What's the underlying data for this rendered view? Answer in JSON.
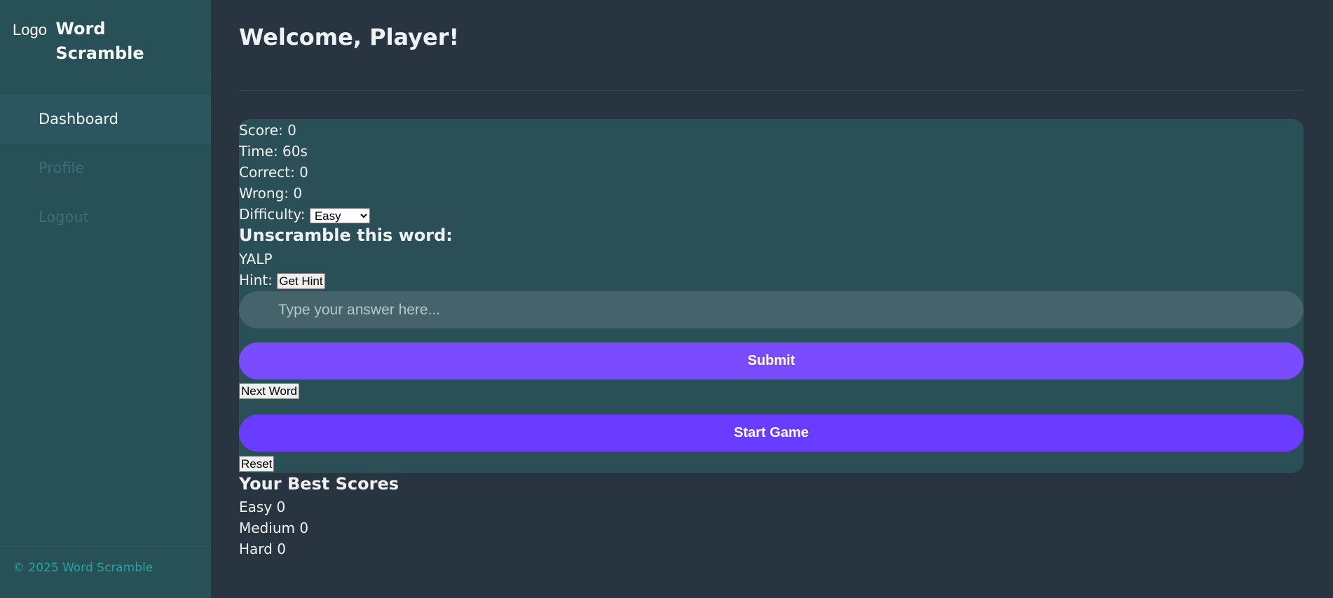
{
  "sidebar": {
    "logo_alt": "Logo",
    "app_title": "Word Scramble",
    "nav": [
      {
        "label": "Dashboard"
      },
      {
        "label": "Profile"
      },
      {
        "label": "Logout"
      }
    ],
    "footer": "© 2025 Word Scramble"
  },
  "header": {
    "title": "Welcome, Player!"
  },
  "game": {
    "score_label": "Score:",
    "score_value": "0",
    "time_label": "Time:",
    "time_value": "60s",
    "correct_label": "Correct:",
    "correct_value": "0",
    "wrong_label": "Wrong:",
    "wrong_value": "0",
    "difficulty_label": "Difficulty:",
    "difficulty_selected": "Easy",
    "prompt": "Unscramble this word:",
    "scrambled_word": "YALP",
    "hint_label": "Hint:",
    "hint_button": "Get Hint",
    "answer_placeholder": "Type your answer here...",
    "answer_value": "",
    "submit_button": "Submit",
    "next_button": "Next Word",
    "start_button": "Start Game",
    "reset_button": "Reset"
  },
  "best_scores": {
    "title": "Your Best Scores",
    "rows": [
      {
        "level": "Easy",
        "score": "0"
      },
      {
        "level": "Medium",
        "score": "0"
      },
      {
        "level": "Hard",
        "score": "0"
      }
    ]
  },
  "colors": {
    "background": "#283440",
    "sidebar": "#275057",
    "card": "#2a4f56",
    "submit": "#7b4bff",
    "start": "#6a3cff",
    "footer_text": "#1fa8a0"
  }
}
